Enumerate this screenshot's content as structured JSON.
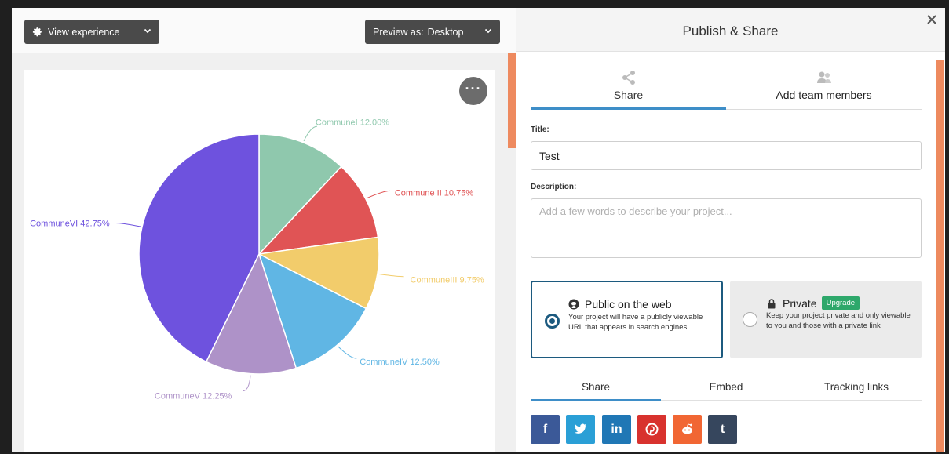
{
  "toolbar": {
    "view_label": "View experience",
    "preview_prefix": "Preview as:",
    "preview_value": "Desktop"
  },
  "chart_data": {
    "type": "pie",
    "title": "",
    "slices": [
      {
        "label": "CommuneI",
        "value": 12.0,
        "display": "CommuneI 12.00%",
        "color": "#8fc8ad"
      },
      {
        "label": "Commune II",
        "value": 10.75,
        "display": "Commune II 10.75%",
        "color": "#e05455"
      },
      {
        "label": "CommuneIII",
        "value": 9.75,
        "display": "CommuneIII 9.75%",
        "color": "#f2cc6b"
      },
      {
        "label": "CommuneIV",
        "value": 12.5,
        "display": "CommuneIV 12.50%",
        "color": "#60b6e4"
      },
      {
        "label": "CommuneV",
        "value": 12.25,
        "display": "CommuneV 12.25%",
        "color": "#ae92c8"
      },
      {
        "label": "CommuneVI",
        "value": 42.75,
        "display": "CommuneVI 42.75%",
        "color": "#6e52de"
      }
    ]
  },
  "panel": {
    "title": "Publish & Share",
    "tabs": [
      {
        "label": "Share",
        "icon": "share-icon"
      },
      {
        "label": "Add team members",
        "icon": "team-members-icon"
      }
    ],
    "title_label": "Title:",
    "title_value": "Test",
    "description_label": "Description:",
    "description_placeholder": "Add a few words to describe your project...",
    "options": {
      "public": {
        "title": "Public on the web",
        "description": "Your project will have a publicly viewable URL that appears in search engines",
        "icon": "github-globe-icon",
        "selected": true
      },
      "private": {
        "title": "Private",
        "badge": "Upgrade",
        "description": "Keep your project private and only viewable to you and those with a private link",
        "icon": "lock-icon",
        "selected": false
      }
    },
    "subtabs": [
      "Share",
      "Embed",
      "Tracking links"
    ],
    "social": [
      {
        "name": "facebook",
        "glyph": "f",
        "color": "#3b5998"
      },
      {
        "name": "twitter",
        "glyph": "",
        "color": "#2a9fd6"
      },
      {
        "name": "linkedin",
        "glyph": "in",
        "color": "#2077b5"
      },
      {
        "name": "pinterest",
        "glyph": "",
        "color": "#d8322e"
      },
      {
        "name": "reddit",
        "glyph": "",
        "color": "#f16633"
      },
      {
        "name": "tumblr",
        "glyph": "t",
        "color": "#36465d"
      }
    ]
  }
}
